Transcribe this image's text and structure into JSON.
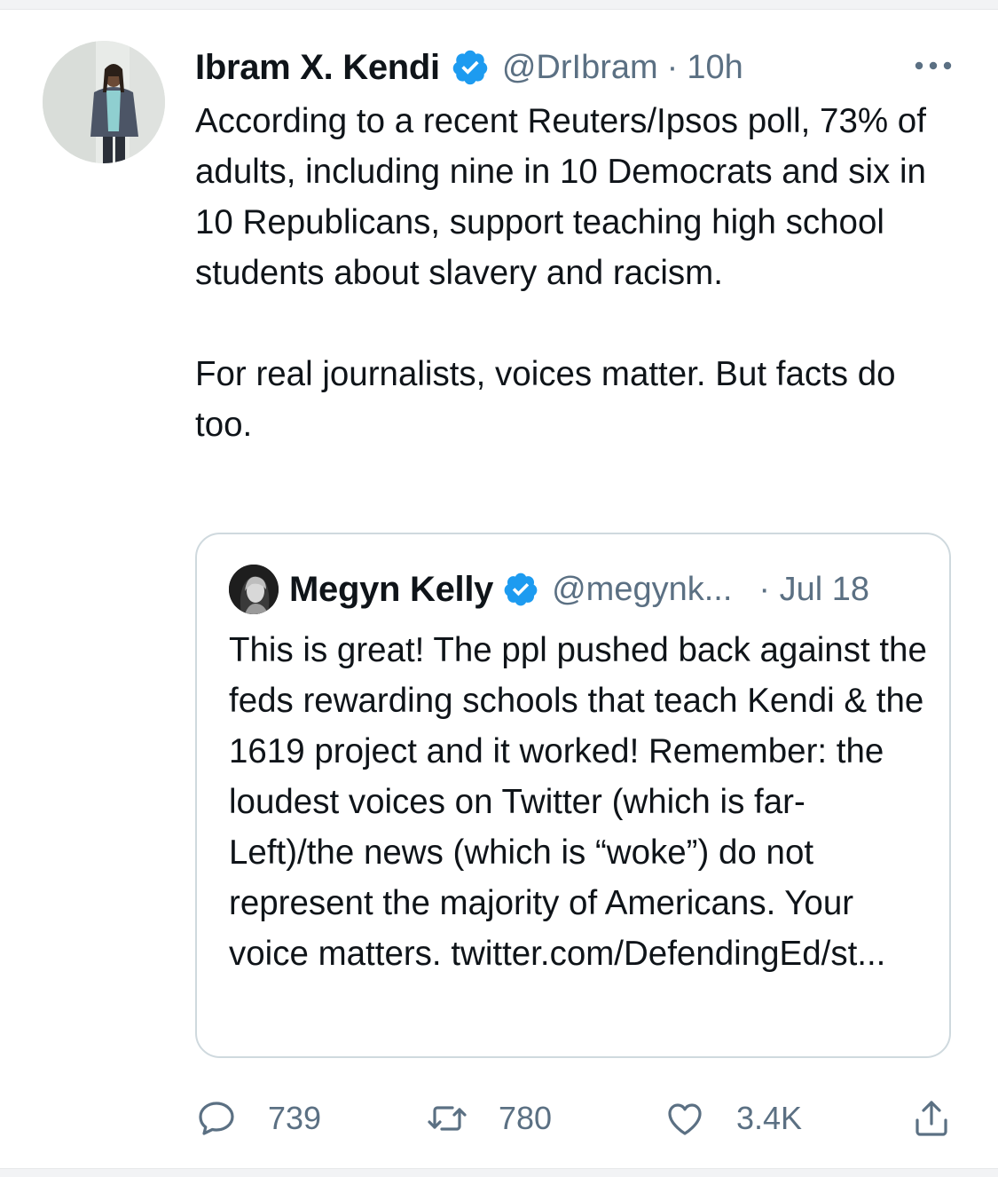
{
  "tweet": {
    "author_name": "Ibram X. Kendi",
    "handle": "@DrIbram",
    "separator": "·",
    "time": "10h",
    "text": "According to a recent Reuters/Ipsos poll, 73% of adults, including nine in 10 Democrats and six in 10 Republicans, support teaching high school students about slavery and racism.\n\nFor real journalists, voices matter. But facts do too.",
    "avatar_icon": "profile-photo",
    "verified_icon": "verified-badge-icon",
    "more_icon": "more-options-icon"
  },
  "quoted_tweet": {
    "author_name": "Megyn Kelly",
    "handle": "@megynk...",
    "date": "· Jul 18",
    "text": "This is great! The ppl pushed back against the feds rewarding schools that teach Kendi & the 1619 project and it worked! Remember: the loudest voices on Twitter (which is far-Left)/the news (which is “woke”) do not represent the majority of Americans. Your voice matters. twitter.com/DefendingEd/st...",
    "verified_icon": "verified-badge-icon"
  },
  "actions": {
    "reply_count": "739",
    "retweet_count": "780",
    "like_count": "3.4K",
    "reply_icon": "reply-icon",
    "retweet_icon": "retweet-icon",
    "like_icon": "heart-icon",
    "share_icon": "share-icon"
  },
  "colors": {
    "verified_blue": "#1d9bf0",
    "secondary_text": "#5b7083",
    "card_border": "#cfd9de"
  }
}
